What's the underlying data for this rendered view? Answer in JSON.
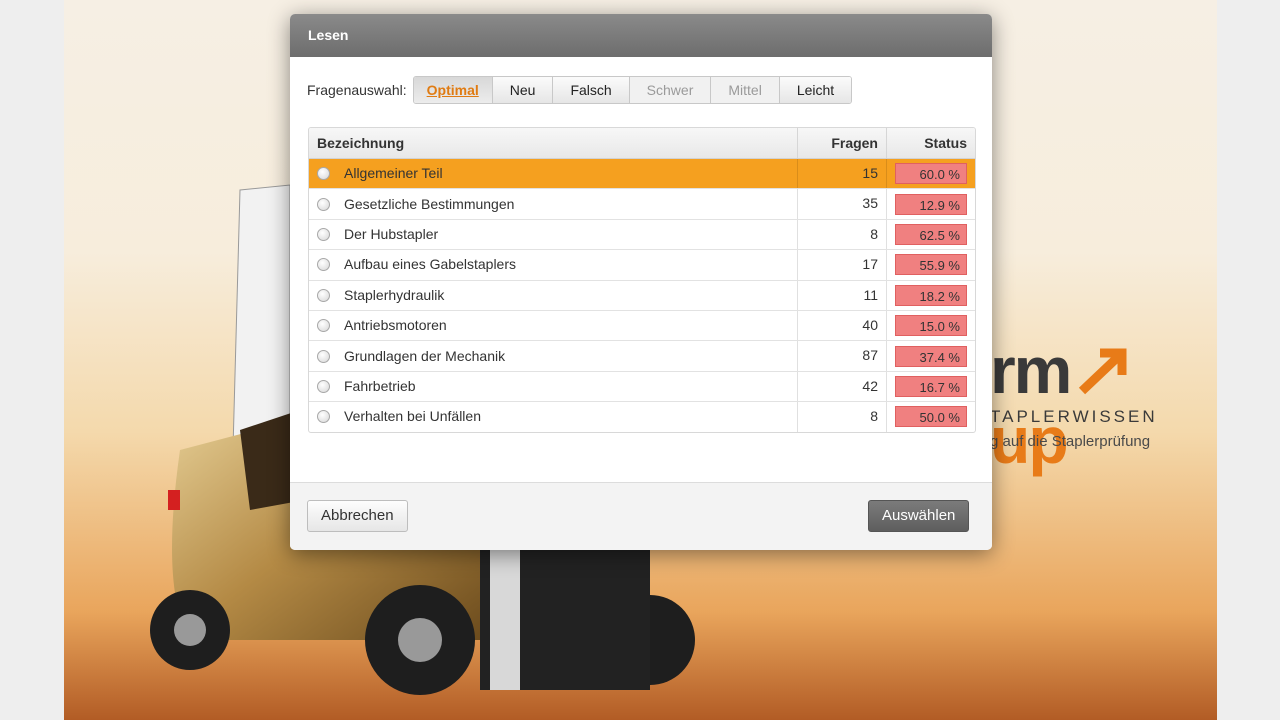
{
  "dialog": {
    "title": "Lesen",
    "filter_label": "Fragenauswahl:",
    "filters": [
      {
        "label": "Optimal",
        "state": "active"
      },
      {
        "label": "Neu",
        "state": "normal"
      },
      {
        "label": "Falsch",
        "state": "normal"
      },
      {
        "label": "Schwer",
        "state": "disabled"
      },
      {
        "label": "Mittel",
        "state": "disabled"
      },
      {
        "label": "Leicht",
        "state": "normal"
      }
    ],
    "table": {
      "headers": {
        "name": "Bezeichnung",
        "questions": "Fragen",
        "status": "Status"
      },
      "rows": [
        {
          "name": "Allgemeiner Teil",
          "questions": "15",
          "status": "60.0 %",
          "selected": true
        },
        {
          "name": "Gesetzliche Bestimmungen",
          "questions": "35",
          "status": "12.9 %",
          "selected": false
        },
        {
          "name": "Der Hubstapler",
          "questions": "8",
          "status": "62.5 %",
          "selected": false
        },
        {
          "name": "Aufbau eines Gabelstaplers",
          "questions": "17",
          "status": "55.9 %",
          "selected": false
        },
        {
          "name": "Staplerhydraulik",
          "questions": "11",
          "status": "18.2 %",
          "selected": false
        },
        {
          "name": "Antriebsmotoren",
          "questions": "40",
          "status": "15.0 %",
          "selected": false
        },
        {
          "name": "Grundlagen der Mechanik",
          "questions": "87",
          "status": "37.4 %",
          "selected": false
        },
        {
          "name": "Fahrbetrieb",
          "questions": "42",
          "status": "16.7 %",
          "selected": false
        },
        {
          "name": "Verhalten bei Unfällen",
          "questions": "8",
          "status": "50.0 %",
          "selected": false
        }
      ]
    },
    "cancel_label": "Abbrechen",
    "confirm_label": "Auswählen"
  },
  "background": {
    "brand_partial": "rm",
    "brand_accent": "up",
    "brand_subtitle": "TAPLERWISSEN",
    "brand_tagline": "g auf die Staplerprüfung"
  },
  "colors": {
    "selected_row": "#f5a01f",
    "status_fill": "#f08080",
    "active_filter_text": "#e07b12",
    "header_bar": "#6d6d6d",
    "brand_accent": "#e87b18"
  }
}
